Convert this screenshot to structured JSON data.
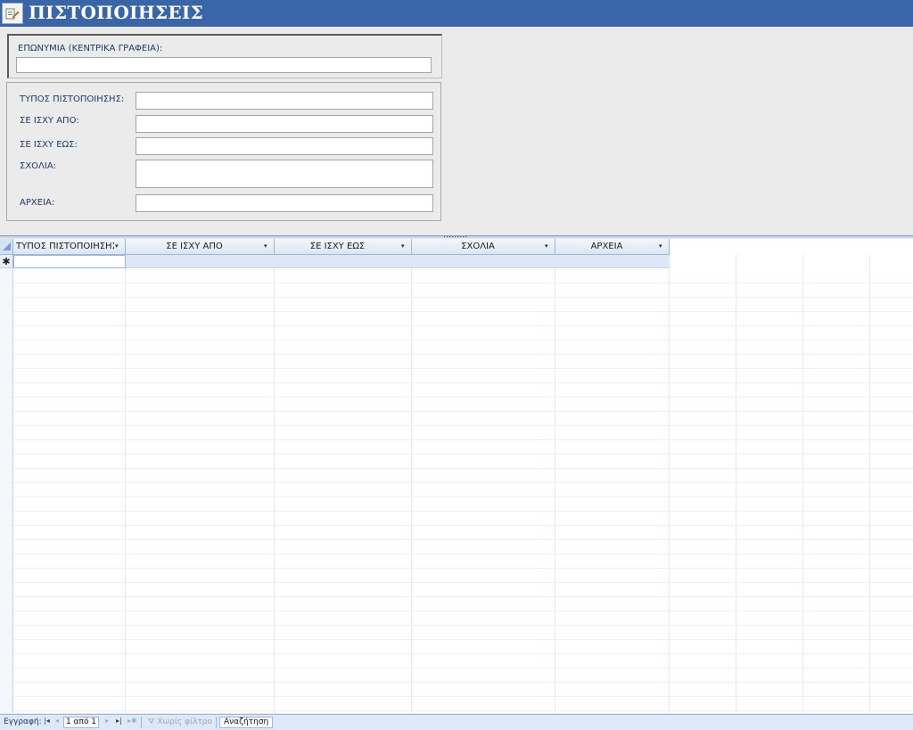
{
  "header": {
    "title": "ΠΙΣΤΟΠΟΙΗΣΕΙΣ",
    "icon": "form-edit-icon",
    "color": "#3a66a7"
  },
  "form": {
    "company_label": "ΕΠΩΝΥΜΙΑ (ΚΕΝΤΡΙΚΑ ΓΡΑΦΕΙΑ):",
    "company_value": "",
    "type_label": "ΤΥΠΟΣ ΠΙΣΤΟΠΟΙΗΣΗΣ:",
    "type_value": "",
    "valid_from_label": "ΣΕ ΙΣΧΥ ΑΠΟ:",
    "valid_from_value": "",
    "valid_to_label": "ΣΕ ΙΣΧΥ ΕΩΣ:",
    "valid_to_value": "",
    "comments_label": "ΣΧΟΛΙΑ:",
    "comments_value": "",
    "files_label": "ΑΡΧΕΙΑ:",
    "files_value": ""
  },
  "datasheet": {
    "columns": [
      {
        "label": "ΤΥΠΟΣ ΠΙΣΤΟΠΟΙΗΣΗΣ"
      },
      {
        "label": "ΣΕ ΙΣΧΥ ΑΠΟ"
      },
      {
        "label": "ΣΕ ΙΣΧΥ ΕΩΣ"
      },
      {
        "label": "ΣΧΟΛΙΑ"
      },
      {
        "label": "ΑΡΧΕΙΑ"
      }
    ],
    "new_row_marker": "✱"
  },
  "status": {
    "record_label": "Εγγραφή:",
    "record_position": "1 από 1",
    "filter_label": "Χωρίς φίλτρο",
    "search_label": "Αναζήτηση",
    "nav_first": "first-record-icon",
    "nav_prev": "previous-record-icon",
    "nav_next": "next-record-icon",
    "nav_last": "last-record-icon",
    "nav_new": "new-record-icon"
  }
}
